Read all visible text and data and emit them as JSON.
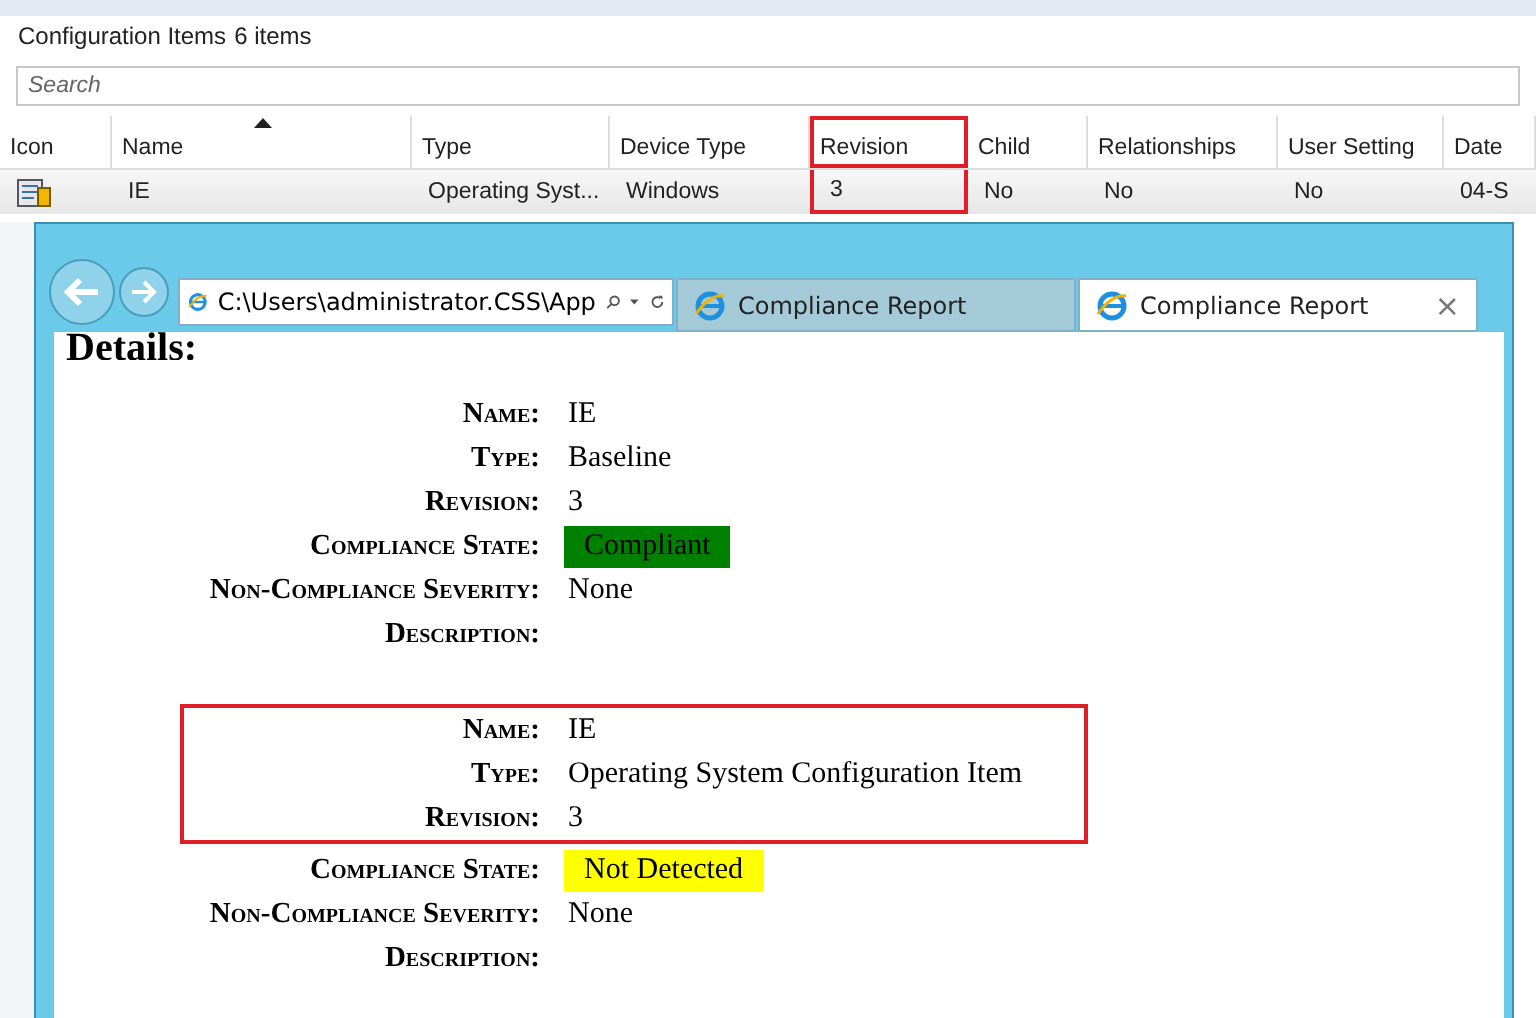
{
  "panel": {
    "title": "Configuration Items",
    "count": "6 items"
  },
  "search": {
    "placeholder": "Search"
  },
  "table": {
    "columns": [
      {
        "label": "Icon",
        "sorted": false,
        "highlighted": false
      },
      {
        "label": "Name",
        "sorted": true,
        "highlighted": false
      },
      {
        "label": "Type",
        "sorted": false,
        "highlighted": false
      },
      {
        "label": "Device Type",
        "sorted": false,
        "highlighted": false
      },
      {
        "label": "Revision",
        "sorted": false,
        "highlighted": true
      },
      {
        "label": "Child",
        "sorted": false,
        "highlighted": false
      },
      {
        "label": "Relationships",
        "sorted": false,
        "highlighted": false
      },
      {
        "label": "User Setting",
        "sorted": false,
        "highlighted": false
      },
      {
        "label": "Date",
        "sorted": false,
        "highlighted": false
      }
    ],
    "rows": [
      {
        "selected": true,
        "cells": [
          "",
          "IE",
          "Operating Syst...",
          "Windows",
          "3",
          "No",
          "No",
          "No",
          "04-S"
        ]
      }
    ]
  },
  "browser": {
    "address": "C:\\Users\\administrator.CSS\\App",
    "tabs": [
      {
        "label": "Compliance Report",
        "selected": false
      },
      {
        "label": "Compliance Report",
        "selected": true
      }
    ],
    "close_glyph": "×",
    "heading": "Details:",
    "sections": [
      {
        "groups": [
          {
            "highlighted": false,
            "rows": [
              {
                "label": "Name:",
                "value": "IE"
              },
              {
                "label": "Type:",
                "value": "Baseline"
              },
              {
                "label": "Revision:",
                "value": "3"
              },
              {
                "label": "Compliance State:",
                "value": "Compliant",
                "color": "#008000"
              },
              {
                "label": "Non-Compliance Severity:",
                "value": "None"
              },
              {
                "label": "Description:"
              }
            ]
          }
        ]
      },
      {
        "groups": [
          {
            "highlighted": true,
            "rows": [
              {
                "label": "Name:",
                "value": "IE"
              },
              {
                "label": "Type:",
                "value": "Operating System Configuration Item"
              },
              {
                "label": "Revision:",
                "value": "3"
              }
            ]
          },
          {
            "highlighted": false,
            "rows": [
              {
                "label": "Compliance State:",
                "value": "Not Detected",
                "color": "#ffff00"
              },
              {
                "label": "Non-Compliance Severity:",
                "value": "None"
              },
              {
                "label": "Description:"
              }
            ]
          }
        ]
      }
    ]
  }
}
